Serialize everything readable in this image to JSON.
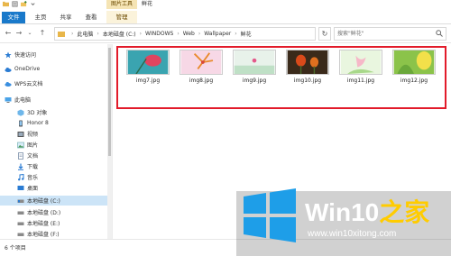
{
  "window": {
    "context_tab_label": "图片工具",
    "title": "鲜花"
  },
  "ribbon": {
    "tabs": [
      {
        "label": "文件"
      },
      {
        "label": "主页"
      },
      {
        "label": "共享"
      },
      {
        "label": "查看"
      },
      {
        "label": "管理"
      }
    ]
  },
  "address": {
    "segments": [
      "此电脑",
      "本地磁盘 (C:)",
      "WINDOWS",
      "Web",
      "Wallpaper",
      "鲜花"
    ],
    "search_placeholder": "搜索\"鲜花\""
  },
  "sidebar": {
    "items": [
      {
        "label": "快速访问",
        "icon": "star-icon"
      },
      {
        "label": "OneDrive",
        "icon": "cloud-icon"
      },
      {
        "label": "WPS云文档",
        "icon": "cloud-icon"
      },
      {
        "label": "此电脑",
        "icon": "computer-icon"
      },
      {
        "label": "3D 对象",
        "icon": "cube-icon"
      },
      {
        "label": "Honor 8",
        "icon": "phone-icon"
      },
      {
        "label": "视频",
        "icon": "video-icon"
      },
      {
        "label": "图片",
        "icon": "image-icon"
      },
      {
        "label": "文档",
        "icon": "document-icon"
      },
      {
        "label": "下载",
        "icon": "download-icon"
      },
      {
        "label": "音乐",
        "icon": "music-icon"
      },
      {
        "label": "桌面",
        "icon": "desktop-icon"
      },
      {
        "label": "本地磁盘 (C:)",
        "icon": "drive-icon"
      },
      {
        "label": "本地磁盘 (D:)",
        "icon": "drive-icon"
      },
      {
        "label": "本地磁盘 (E:)",
        "icon": "drive-icon"
      },
      {
        "label": "本地磁盘 (F:)",
        "icon": "drive-icon"
      }
    ]
  },
  "files": [
    {
      "name": "img7.jpg"
    },
    {
      "name": "img8.jpg"
    },
    {
      "name": "img9.jpg"
    },
    {
      "name": "img10.jpg"
    },
    {
      "name": "img11.jpg"
    },
    {
      "name": "img12.jpg"
    }
  ],
  "status": {
    "item_count": "6 个项目"
  },
  "watermark": {
    "brand_main": "Win10",
    "brand_suffix": "之家",
    "url": "www.win10xitong.com"
  },
  "colors": {
    "selection_border": "#e21b2a",
    "file_tab": "#1979ca",
    "context_tab": "#f5e4b4",
    "win_logo_blue": "#1e9ee8",
    "brand_accent": "#ffcc00"
  }
}
